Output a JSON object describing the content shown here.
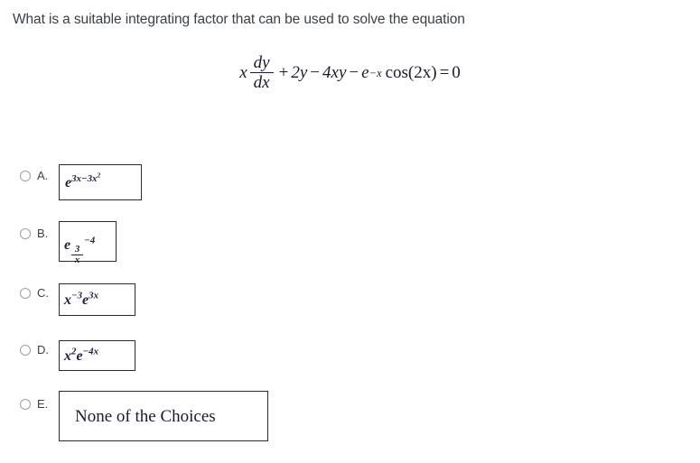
{
  "question": {
    "stem": "What is a suitable integrating factor that can be used to solve the equation",
    "equation_plain": "x dy/dx + 2y - 4xy - e^(-x) cos(2x) = 0",
    "equation_parts": {
      "lead_var": "x",
      "frac_num": "dy",
      "frac_den": "dx",
      "plus": "+",
      "term_2y": "2y",
      "minus1": "−",
      "term_4xy": "4xy",
      "minus2": "−",
      "e_base": "e",
      "e_exp": "−x",
      "cos": "cos(2x)",
      "equals": "=",
      "rhs": "0"
    }
  },
  "options": [
    {
      "letter": "A.",
      "value_plain": "e^(3x-3x^2)",
      "base": "e",
      "exponent": "3x−3x",
      "exponent_sup": "2",
      "kind": "power"
    },
    {
      "letter": "B.",
      "value_plain": "e^(3/x - 4)",
      "base": "e",
      "frac_num": "3",
      "frac_den": "x",
      "tail": "−4",
      "kind": "frac-power"
    },
    {
      "letter": "C.",
      "value_plain": "x^(-3) e^(3x)",
      "x_base": "x",
      "x_exp": "−3",
      "e_base": "e",
      "e_exp": "3x",
      "kind": "product"
    },
    {
      "letter": "D.",
      "value_plain": "x^2 e^(-4x)",
      "x_base": "x",
      "x_exp": "2",
      "e_base": "e",
      "e_exp": "−4x",
      "kind": "product"
    },
    {
      "letter": "E.",
      "value_plain": "None of the Choices",
      "text": "None of the Choices",
      "kind": "text"
    }
  ],
  "colors": {
    "page_background": "#ffffff",
    "stem_text": "#3b4046",
    "math_text": "#1f1f3d",
    "box_border": "#2b2b2b",
    "radio_border": "#9aa0a6"
  }
}
